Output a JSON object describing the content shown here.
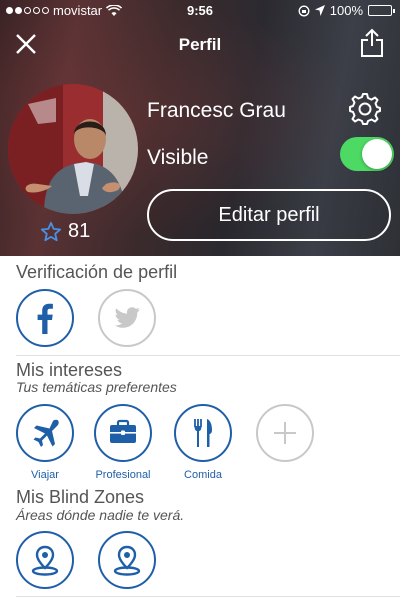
{
  "status_bar": {
    "carrier": "movistar",
    "time": "9:56",
    "battery": "100%"
  },
  "nav": {
    "title": "Perfil"
  },
  "profile": {
    "name": "Francesc Grau",
    "rating": "81",
    "visible_label": "Visible",
    "visible_on": true,
    "edit_label": "Editar perfil"
  },
  "verification": {
    "title": "Verificación de perfil"
  },
  "interests": {
    "title": "Mis intereses",
    "subtitle": "Tus temáticas preferentes",
    "items": [
      {
        "label": "Viajar",
        "icon": "airplane-icon"
      },
      {
        "label": "Profesional",
        "icon": "briefcase-icon"
      },
      {
        "label": "Comida",
        "icon": "fork-knife-icon"
      }
    ]
  },
  "blind_zones": {
    "title": "Mis Blind Zones",
    "subtitle": "Áreas dónde nadie te verá."
  },
  "colors": {
    "accent": "#1f5fa8",
    "toggle_on": "#4cd964"
  }
}
